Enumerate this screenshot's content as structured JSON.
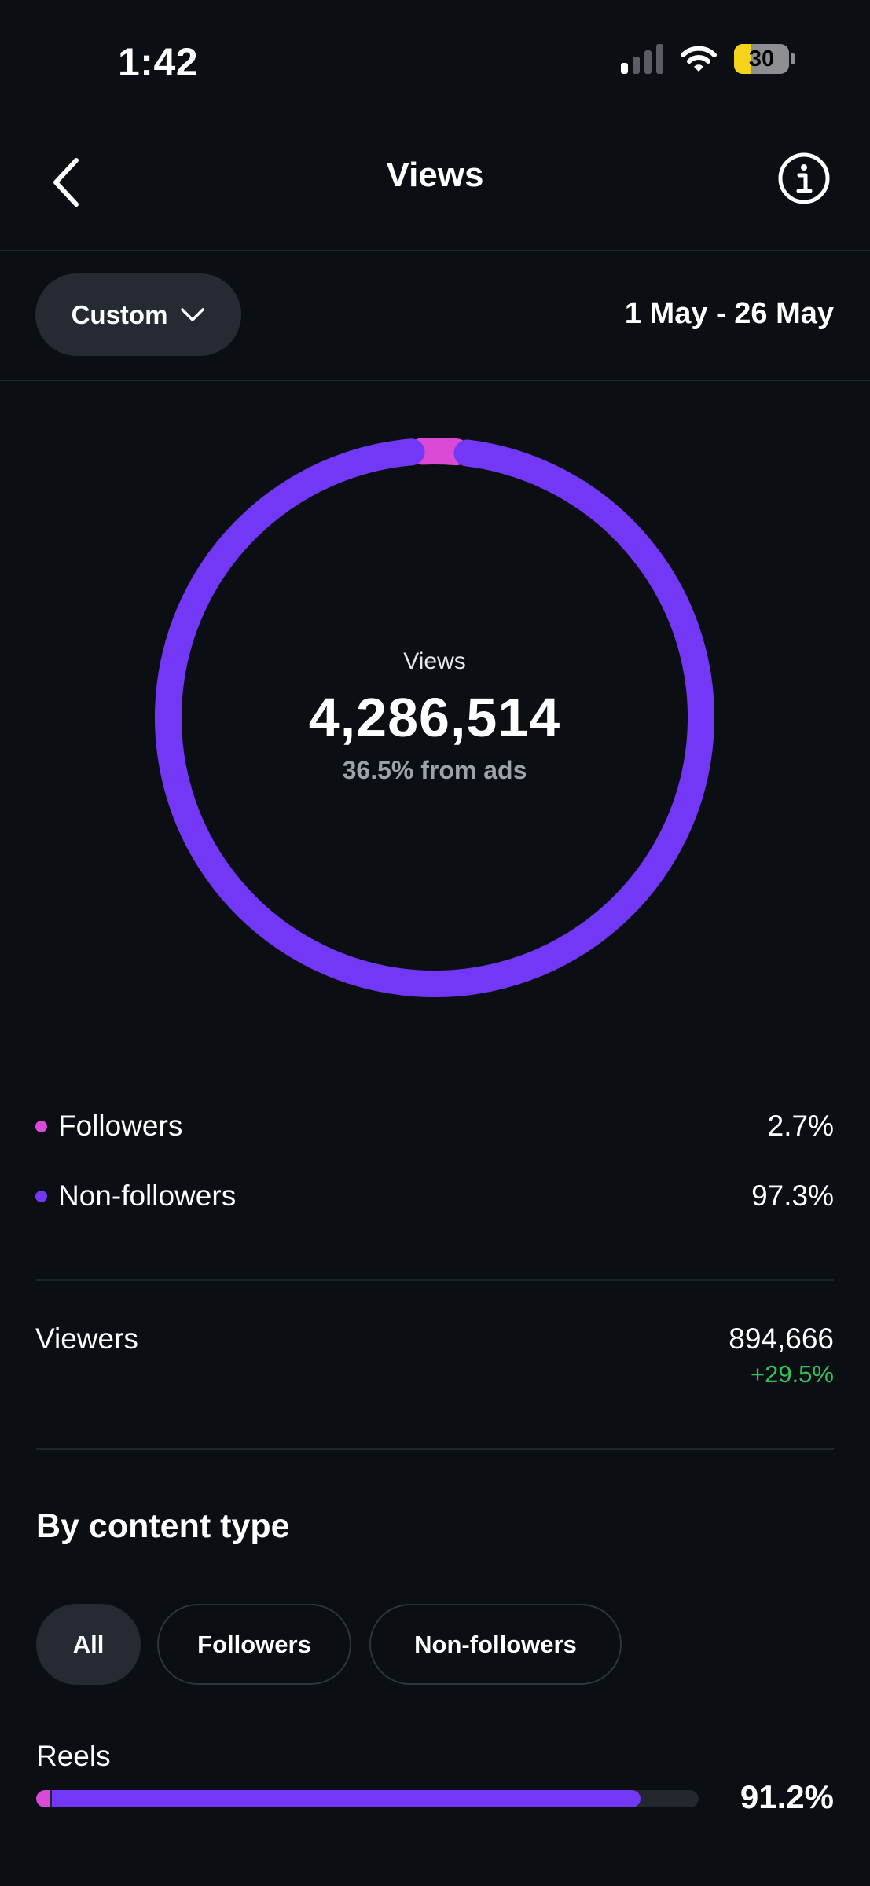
{
  "status_bar": {
    "time": "1:42",
    "battery": "30",
    "battery_fraction": 0.3,
    "signal_bars_on": 1,
    "signal_bars_total": 4
  },
  "header": {
    "title": "Views",
    "back_icon": "chevron-left-icon",
    "info_icon": "info-icon"
  },
  "filter": {
    "range_button": "Custom",
    "date_range": "1 May - 26 May"
  },
  "donut": {
    "label": "Views",
    "total": "4,286,514",
    "subtext": "36.5% from ads",
    "segments": [
      {
        "name": "Followers",
        "fraction": 0.027,
        "color": "#d94bd6"
      },
      {
        "name": "Non-followers",
        "fraction": 0.973,
        "color": "#7338f5"
      }
    ]
  },
  "legend": [
    {
      "label": "Followers",
      "value": "2.7%",
      "color": "#d94bd6"
    },
    {
      "label": "Non-followers",
      "value": "97.3%",
      "color": "#7338f5"
    }
  ],
  "viewers": {
    "label": "Viewers",
    "value": "894,666",
    "change": "+29.5%"
  },
  "content_type": {
    "title": "By content type",
    "tabs": [
      {
        "label": "All",
        "active": true
      },
      {
        "label": "Followers",
        "active": false
      },
      {
        "label": "Non-followers",
        "active": false
      }
    ],
    "rows": [
      {
        "label": "Reels",
        "value": "91.2%",
        "fraction": 0.912,
        "followers_fraction": 0.02
      }
    ]
  },
  "colors": {
    "background": "#0b0e13",
    "followers": "#d94bd6",
    "non_followers": "#7338f5",
    "positive": "#31c25b"
  }
}
